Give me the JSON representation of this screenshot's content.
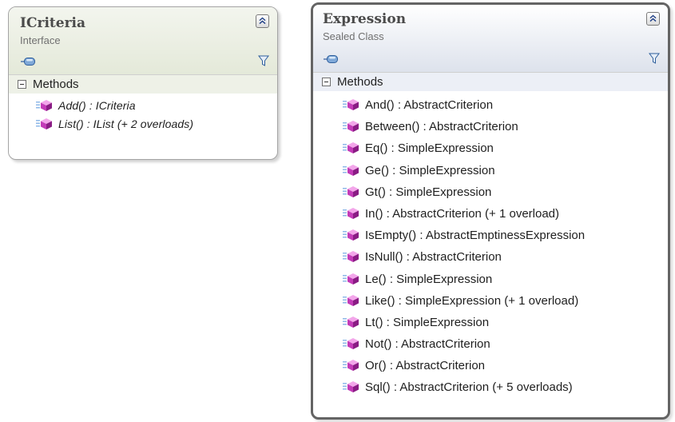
{
  "shapes": {
    "icriteria": {
      "name": "ICriteria",
      "stereotype": "Interface",
      "section_label": "Methods",
      "members": [
        "Add() : ICriteria",
        "List() : IList (+ 2 overloads)"
      ],
      "icons": [
        "collapse-icon",
        "shortcut-icon",
        "filter-icon",
        "method-icon"
      ]
    },
    "expression": {
      "name": "Expression",
      "stereotype": "Sealed Class",
      "section_label": "Methods",
      "members": [
        "And() : AbstractCriterion",
        "Between() : AbstractCriterion",
        "Eq() : SimpleExpression",
        "Ge() : SimpleExpression",
        "Gt() : SimpleExpression",
        "In() : AbstractCriterion (+ 1 overload)",
        "IsEmpty() : AbstractEmptinessExpression",
        "IsNull() : AbstractCriterion",
        "Le() : SimpleExpression",
        "Like() : SimpleExpression (+ 1 overload)",
        "Lt() : SimpleExpression",
        "Not() : AbstractCriterion",
        "Or() : AbstractCriterion",
        "Sql() : AbstractCriterion (+ 5 overloads)"
      ],
      "icons": [
        "collapse-icon",
        "shortcut-icon",
        "filter-icon",
        "method-icon"
      ]
    }
  },
  "colors": {
    "interface_header": "#e4e9d9",
    "class_header": "#dde2ec",
    "method_icon": "#c43bb8",
    "selected_border": "#646464"
  }
}
